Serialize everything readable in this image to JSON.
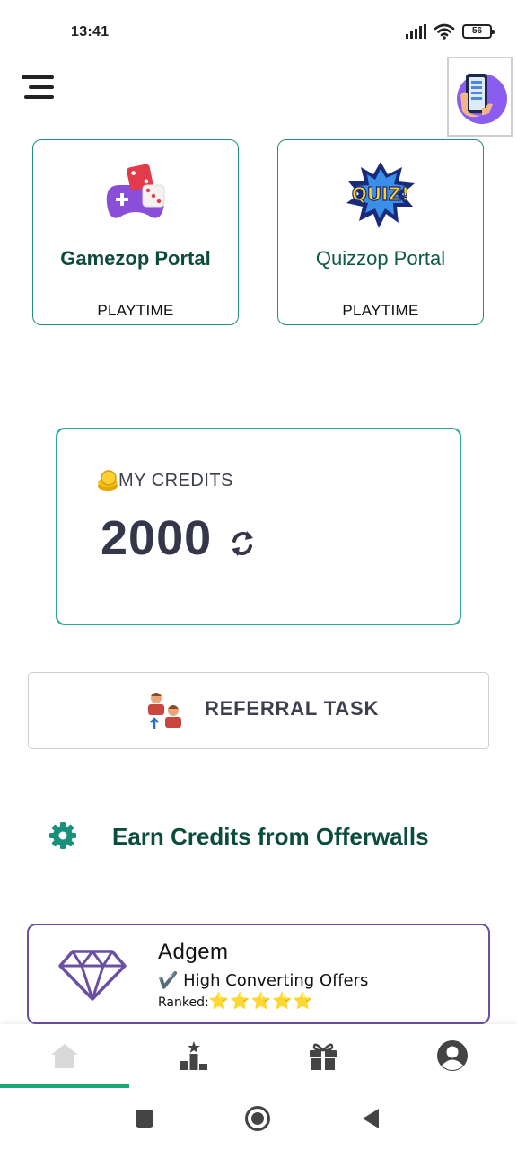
{
  "status_bar": {
    "time": "13:41",
    "battery": "56",
    "icons": [
      "signal-icon",
      "wifi-icon",
      "battery-icon"
    ]
  },
  "header": {
    "menu_icon": "hamburger-menu-icon",
    "profile_icon": "phone-in-hand-icon"
  },
  "portals": [
    {
      "title": "Gamezop Portal",
      "subtitle": "PLAYTIME",
      "icon": "gamepad-dice-icon"
    },
    {
      "title": "Quizzop Portal",
      "subtitle": "PLAYTIME",
      "icon": "quiz-burst-icon"
    }
  ],
  "credits": {
    "label": "MY CREDITS",
    "value": "2000",
    "icon": "coin-stack-icon",
    "refresh_icon": "refresh-icon"
  },
  "referral": {
    "label": "REFERRAL TASK",
    "icon": "referral-people-icon"
  },
  "offerwalls": {
    "heading": "Earn Credits from Offerwalls",
    "icon": "gear-icon"
  },
  "offers": [
    {
      "name": "Adgem",
      "tagline": "✔️ High Converting Offers",
      "ranked_label": "Ranked:",
      "stars": "⭐⭐⭐⭐⭐",
      "icon": "diamond-gem-icon"
    }
  ],
  "bottom_nav": {
    "items": [
      "home-icon",
      "leaderboard-icon",
      "gift-icon",
      "account-icon"
    ],
    "active_index": 0
  },
  "system_nav": [
    "recents-square-icon",
    "home-circle-icon",
    "back-triangle-icon"
  ],
  "colors": {
    "accent_green": "#1aa874",
    "teal_border": "#2aa99b",
    "dark_green_text": "#0b4d3d",
    "purple_border": "#6a4fa2",
    "star_yellow": "#f6c325"
  }
}
